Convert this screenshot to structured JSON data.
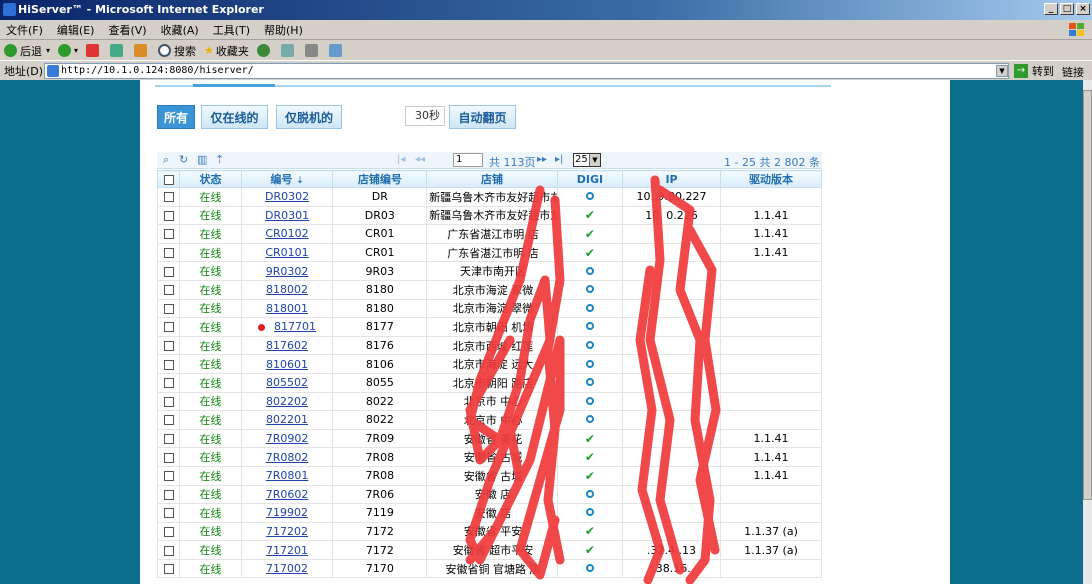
{
  "window": {
    "title": "HiServer™ - Microsoft Internet Explorer"
  },
  "menu": [
    "文件(F)",
    "编辑(E)",
    "查看(V)",
    "收藏(A)",
    "工具(T)",
    "帮助(H)"
  ],
  "toolbar": {
    "back": "后退",
    "search": "搜索",
    "favorites": "收藏夹"
  },
  "address": {
    "label": "地址(D)",
    "url": "http://10.1.0.124:8080/hiserver/",
    "go": "转到",
    "links": "链接"
  },
  "filters": {
    "all": "所有",
    "online_only": "仅在线的",
    "offline_only": "仅脱机的",
    "interval": "30秒",
    "auto_page": "自动翻页"
  },
  "pager": {
    "page": "1",
    "total_pages": "共 113页",
    "page_size": "25",
    "info": "1 - 25   共 2 802 条"
  },
  "columns": [
    "状态",
    "编号",
    "店铺编号",
    "店铺",
    "DIGI",
    "IP",
    "驱动版本"
  ],
  "rows": [
    {
      "status": "在线",
      "code": "DR0302",
      "shop_no": "DR",
      "shop": "新疆乌鲁木齐市友好超市友",
      "digi": "o",
      "ip": "10.  9.80.227",
      "driver": ""
    },
    {
      "status": "在线",
      "code": "DR0301",
      "shop_no": "DR03",
      "shop": "新疆乌鲁木齐市友好超市友",
      "digi": "v",
      "ip": "10.    0.226",
      "driver": "1.1.41"
    },
    {
      "status": "在线",
      "code": "CR0102",
      "shop_no": "CR01",
      "shop": "  广东省湛江市明    店",
      "digi": "v",
      "ip": "",
      "driver": "1.1.41"
    },
    {
      "status": "在线",
      "code": "CR0101",
      "shop_no": "CR01",
      "shop": "  广东省湛江市明    店",
      "digi": "v",
      "ip": "",
      "driver": "1.1.41"
    },
    {
      "status": "在线",
      "code": "9R0302",
      "shop_no": "9R03",
      "shop": "  天津市南开区",
      "digi": "o",
      "ip": "",
      "driver": ""
    },
    {
      "status": "在线",
      "code": "818002",
      "shop_no": "8180",
      "shop": "北京市海淀      翠微",
      "digi": "o",
      "ip": "",
      "driver": ""
    },
    {
      "status": "在线",
      "code": "818001",
      "shop_no": "8180",
      "shop": "北京市海淀      翠微",
      "digi": "o",
      "ip": "",
      "driver": ""
    },
    {
      "status": "在线",
      "code": "817701",
      "shop_no": "8177",
      "shop": "北京市朝阳      机场",
      "digi": "o",
      "ip": "",
      "driver": "",
      "alert": true
    },
    {
      "status": "在线",
      "code": "817602",
      "shop_no": "8176",
      "shop": "北京市西城      红莲",
      "digi": "o",
      "ip": "",
      "driver": ""
    },
    {
      "status": "在线",
      "code": "810601",
      "shop_no": "8106",
      "shop": "北京市海淀      远大",
      "digi": "o",
      "ip": "",
      "driver": ""
    },
    {
      "status": "在线",
      "code": "805502",
      "shop_no": "8055",
      "shop": "北京市朝阳      路店",
      "digi": "o",
      "ip": "",
      "driver": ""
    },
    {
      "status": "在线",
      "code": "802202",
      "shop_no": "8022",
      "shop": "北京市      中心",
      "digi": "o",
      "ip": "",
      "driver": ""
    },
    {
      "status": "在线",
      "code": "802201",
      "shop_no": "8022",
      "shop": "北京市      中心",
      "digi": "o",
      "ip": "",
      "driver": ""
    },
    {
      "status": "在线",
      "code": "7R0902",
      "shop_no": "7R09",
      "shop": "安徽省      美花",
      "digi": "v",
      "ip": "",
      "driver": "1.1.41"
    },
    {
      "status": "在线",
      "code": "7R0802",
      "shop_no": "7R08",
      "shop": "安徽省      古城",
      "digi": "v",
      "ip": "",
      "driver": "1.1.41"
    },
    {
      "status": "在线",
      "code": "7R0801",
      "shop_no": "7R08",
      "shop": "安徽省      古城",
      "digi": "v",
      "ip": "",
      "driver": "1.1.41"
    },
    {
      "status": "在线",
      "code": "7R0602",
      "shop_no": "7R06",
      "shop": "  安徽      店",
      "digi": "o",
      "ip": "",
      "driver": ""
    },
    {
      "status": "在线",
      "code": "719902",
      "shop_no": "7119",
      "shop": "  安徽      店",
      "digi": "o",
      "ip": "",
      "driver": ""
    },
    {
      "status": "在线",
      "code": "717202",
      "shop_no": "7172",
      "shop": "安徽省      平安",
      "digi": "v",
      "ip": "",
      "driver": "1.1.37 (a)"
    },
    {
      "status": "在线",
      "code": "717201",
      "shop_no": "7172",
      "shop": "安徽省      超市平安",
      "digi": "v",
      "ip": "  .32.4   .13",
      "driver": "1.1.37 (a)"
    },
    {
      "status": "在线",
      "code": "717002",
      "shop_no": "7170",
      "shop": "  安徽省铜   官塘路   店",
      "digi": "o",
      "ip": "  .38.16.  ",
      "driver": ""
    }
  ]
}
